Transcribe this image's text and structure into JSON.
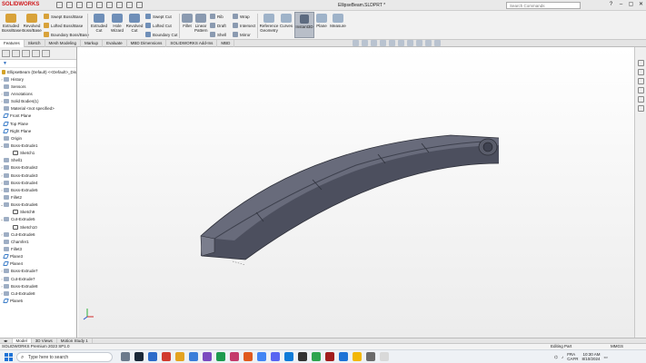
{
  "titlebar": {
    "app_name": "SOLIDWORKS",
    "document_title": "EllipseBeam.SLDPRT *",
    "search_placeholder": "Search Commands"
  },
  "ribbon": {
    "extruded_boss": "Extruded Boss/Base",
    "revolved_boss": "Revolved Boss/Base",
    "swept_boss": "Swept Boss/Base",
    "lofted_boss": "Lofted Boss/Base",
    "boundary_boss": "Boundary Boss/Base",
    "extruded_cut": "Extruded Cut",
    "hole_wizard": "Hole Wizard",
    "revolved_cut": "Revolved Cut",
    "swept_cut": "Swept Cut",
    "lofted_cut": "Lofted Cut",
    "boundary_cut": "Boundary Cut",
    "fillet": "Fillet",
    "linear_pattern": "Linear Pattern",
    "rib": "Rib",
    "draft": "Draft",
    "shell": "Shell",
    "wrap": "Wrap",
    "intersect": "Intersect",
    "mirror": "Mirror",
    "reference_geometry": "Reference Geometry",
    "curves": "Curves",
    "instant3d": "Instant3D",
    "plane": "Plane",
    "measure": "Measure"
  },
  "command_tabs": [
    "Features",
    "Sketch",
    "Mesh Modeling",
    "Markup",
    "Evaluate",
    "MBD Dimensions",
    "SOLIDWORKS Add-Ins",
    "MBD"
  ],
  "feature_tree": [
    {
      "label": "EllipseBeam (Default) <<Default>_Dis",
      "kind": "root",
      "arrow": ""
    },
    {
      "label": "History",
      "kind": "feat",
      "arrow": "›"
    },
    {
      "label": "Sensors",
      "kind": "feat",
      "arrow": ""
    },
    {
      "label": "Annotations",
      "kind": "feat",
      "arrow": "›"
    },
    {
      "label": "Solid Bodies(1)",
      "kind": "feat",
      "arrow": "›"
    },
    {
      "label": "Material <not specified>",
      "kind": "feat",
      "arrow": ""
    },
    {
      "label": "Front Plane",
      "kind": "plane",
      "arrow": ""
    },
    {
      "label": "Top Plane",
      "kind": "plane",
      "arrow": ""
    },
    {
      "label": "Right Plane",
      "kind": "plane",
      "arrow": ""
    },
    {
      "label": "Origin",
      "kind": "feat",
      "arrow": ""
    },
    {
      "label": "Boss-Extrude1",
      "kind": "feat",
      "arrow": "⌄"
    },
    {
      "label": "Sketch1",
      "kind": "sketch",
      "arrow": "",
      "indent": true
    },
    {
      "label": "Shell1",
      "kind": "feat",
      "arrow": ""
    },
    {
      "label": "Boss-Extrude2",
      "kind": "feat",
      "arrow": "›"
    },
    {
      "label": "Boss-Extrude3",
      "kind": "feat",
      "arrow": "›"
    },
    {
      "label": "Boss-Extrude4",
      "kind": "feat",
      "arrow": "›"
    },
    {
      "label": "Boss-Extrude5",
      "kind": "feat",
      "arrow": "›"
    },
    {
      "label": "Fillet2",
      "kind": "feat",
      "arrow": ""
    },
    {
      "label": "Boss-Extrude6",
      "kind": "feat",
      "arrow": "⌄"
    },
    {
      "label": "Sketch9",
      "kind": "sketch",
      "arrow": "",
      "indent": true
    },
    {
      "label": "Cut-Extrude5",
      "kind": "feat",
      "arrow": "⌄"
    },
    {
      "label": "Sketch10",
      "kind": "sketch",
      "arrow": "",
      "indent": true
    },
    {
      "label": "Cut-Extrude6",
      "kind": "feat",
      "arrow": "›"
    },
    {
      "label": "Chamfer1",
      "kind": "feat",
      "arrow": ""
    },
    {
      "label": "Fillet3",
      "kind": "feat",
      "arrow": ""
    },
    {
      "label": "Plane3",
      "kind": "plane",
      "arrow": ""
    },
    {
      "label": "Plane4",
      "kind": "plane",
      "arrow": ""
    },
    {
      "label": "Boss-Extrude7",
      "kind": "feat",
      "arrow": "›"
    },
    {
      "label": "Cut-Extrude7",
      "kind": "feat",
      "arrow": "›"
    },
    {
      "label": "Boss-Extrude8",
      "kind": "feat",
      "arrow": "›"
    },
    {
      "label": "Cut-Extrude8",
      "kind": "feat",
      "arrow": "›"
    },
    {
      "label": "Plane5",
      "kind": "plane",
      "arrow": ""
    }
  ],
  "bottom_tabs": [
    "Model",
    "3D Views",
    "Motion Study 1"
  ],
  "status": {
    "version": "SOLIDWORKS Premium 2023 SP1.0",
    "mode": "Editing Part",
    "units": "MMGS"
  },
  "taskbar": {
    "search_text": "Type here to search",
    "lang_line1": "FRA",
    "lang_line2": "CAFR",
    "time": "10:30 AM",
    "date": "8/10/2024"
  },
  "colors": {
    "brand": "#d0191c",
    "model_fill": "#5d6070",
    "accent": "#1e73d6"
  }
}
